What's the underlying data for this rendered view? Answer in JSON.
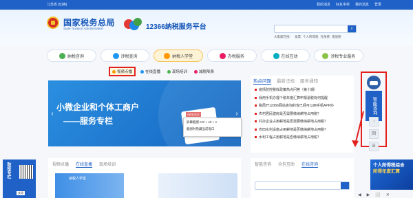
{
  "topbar": {
    "location": "江苏省 [切换]",
    "links": [
      "我的消息",
      "好友中奖",
      "我的消息",
      "登录"
    ]
  },
  "header": {
    "brand_title": "国家税务总局",
    "brand_sub": "State Taxation Administration",
    "platform_title": "12366纳税服务平台",
    "search_btn": "⌕",
    "hot_label": "大家都在搜：",
    "hot_items": [
      "发票",
      "个人所得税",
      "社保费",
      "增值税"
    ]
  },
  "nav": [
    {
      "label": "纳税咨询",
      "color": "#4caf50"
    },
    {
      "label": "涉税查询",
      "color": "#2196f3"
    },
    {
      "label": "纳税人学堂",
      "color": "#ff9800",
      "active": true
    },
    {
      "label": "办税服务",
      "color": "#e91e63"
    },
    {
      "label": "在线互动",
      "color": "#00acc1"
    },
    {
      "label": "涉税专业服务",
      "color": "#8bc34a"
    }
  ],
  "subnav": [
    {
      "label": "视频点播",
      "color": "#ff9800",
      "highlight": true
    },
    {
      "label": "在线直播",
      "color": "#2196f3"
    },
    {
      "label": "现场培训",
      "color": "#4caf50"
    },
    {
      "label": "减税降费",
      "color": "#e91e63"
    }
  ],
  "banner": {
    "line1": "小微企业和个体工商户",
    "line2": "——服务专栏",
    "service": "SERVICE",
    "prev": "‹",
    "next": "›"
  },
  "tooltip": {
    "line1": "屏幕截图 Ctrl + Alt + A",
    "line2": "截图时隐藏当前窗口"
  },
  "news": {
    "tabs": [
      "热点问题",
      "最新法规",
      "服务通知"
    ],
    "items": [
      "疫情防控税收政策热点问答（第十期）",
      "我用手机办理个税年度汇算申报退税有何提醒",
      "税局开12366网站咨询的省已经可以用手机APP办",
      "农村居民建房是否需要缴纳耕地占用税？",
      "村办企业占用耕地是否需要缴纳耕地占用税？",
      "农田水利设施占用耕地是否缴纳耕地占用税？",
      "水利工程占用耕地是否缴纳耕地占用税？"
    ]
  },
  "smart": {
    "label": "智能咨询"
  },
  "side_tools": [
    "↑",
    "回",
    "☰"
  ],
  "left_ad": {
    "text": "防疫专栏",
    "close": "关闭"
  },
  "bottom_left": {
    "tabs": [
      "视频点播",
      "在线直播",
      "现场培训"
    ],
    "thumb_text": "纳税人学堂"
  },
  "bottom_right": {
    "tabs": [
      "智能咨询",
      "众包互助",
      "在线咨询"
    ]
  },
  "right_ad": {
    "line1": "个人所得税综合",
    "line2": "所得年度汇算"
  },
  "win_controls": [
    "◀",
    "▶",
    "⬜",
    "✕"
  ]
}
